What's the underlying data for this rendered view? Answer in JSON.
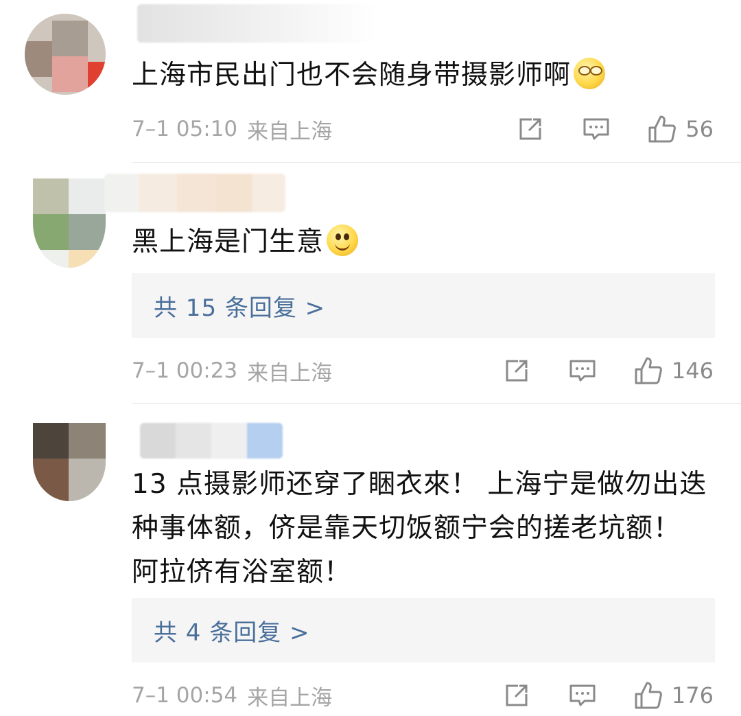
{
  "comments": [
    {
      "text": "上海市民出门也不会随身带摄影师啊",
      "emoji": "dizzy-face-emoji",
      "time": "7–1 05:10",
      "location": "来自上海",
      "likes": "56"
    },
    {
      "text": "黑上海是门生意",
      "emoji": "smile-emoji",
      "replies": "共 15 条回复 >",
      "time": "7–1 00:23",
      "location": "来自上海",
      "likes": "146"
    },
    {
      "text": "13 点摄影师还穿了睏衣來！ 上海宁是做勿出迭种事体额，侪是靠天切饭额宁会的搓老坑额！ 阿拉侪有浴室额！",
      "replies": "共 4 条回复 >",
      "time": "7–1 00:54",
      "location": "来自上海",
      "likes": "176"
    }
  ],
  "icons": {
    "share": "share-icon",
    "comment": "comment-icon",
    "like": "thumbs-up-icon"
  },
  "colors": {
    "reply_link": "#4a6f9b",
    "meta_gray": "#a5a5a5",
    "reply_bg": "#f5f5f5"
  }
}
